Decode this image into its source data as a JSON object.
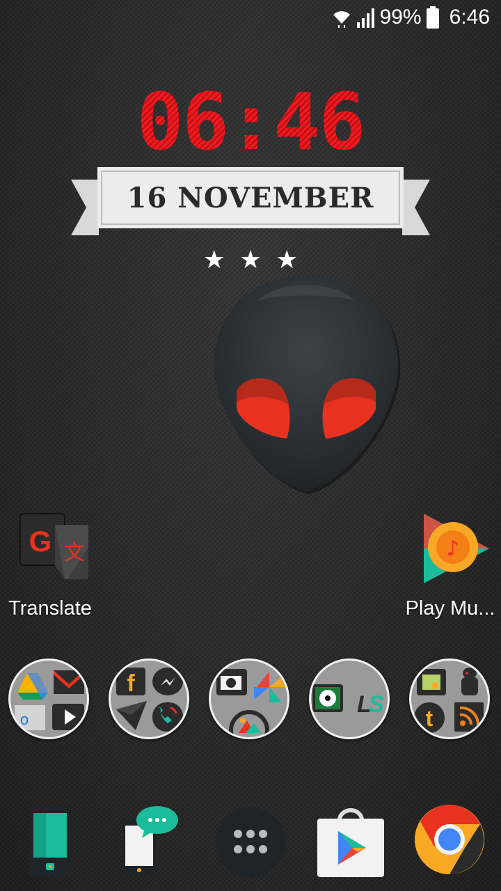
{
  "status_bar": {
    "battery_percent": "99%",
    "time": "6:46"
  },
  "clock_widget": {
    "time": "06:46",
    "date": "16 NOVEMBER"
  },
  "apps": [
    {
      "label": "Translate",
      "icon": "google-translate-icon"
    },
    {
      "label": "Play Mu...",
      "icon": "play-music-icon"
    }
  ],
  "folders": [
    {
      "icons": [
        "drive-icon",
        "gmail-icon",
        "outlook-icon",
        "play-video-icon"
      ]
    },
    {
      "icons": [
        "facebook-icon",
        "messenger-icon",
        "send-icon",
        "phone-icon"
      ]
    },
    {
      "icons": [
        "camera-icon",
        "photos-pinwheel-icon",
        "gallery-icon"
      ]
    },
    {
      "icons": [
        "soccer-icon",
        "ls-icon"
      ]
    },
    {
      "icons": [
        "android-icon",
        "robot-icon",
        "tumblr-icon",
        "rss-icon"
      ]
    }
  ],
  "dock": [
    {
      "icon": "phone-device-icon"
    },
    {
      "icon": "messaging-icon"
    },
    {
      "icon": "app-drawer-icon"
    },
    {
      "icon": "play-store-icon"
    },
    {
      "icon": "chrome-icon"
    }
  ],
  "colors": {
    "clock_red": "#e3141a",
    "ribbon": "#ececec",
    "alien_eye": "#e8321f"
  }
}
